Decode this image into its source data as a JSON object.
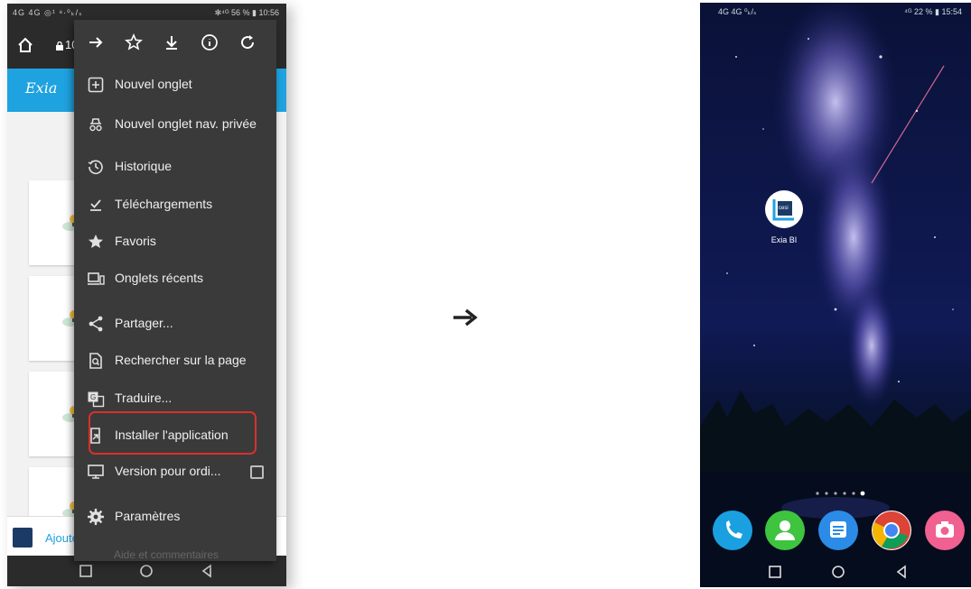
{
  "left_phone": {
    "status": {
      "left": "4G  4G  ◎¹  ⁸·⁰ₖ/ₛ",
      "right": "✻⁴ᴳ 56 % ▮ 10:56"
    },
    "url_text": "10",
    "site_logo": "Exia",
    "bottom_banner_text": "Ajouter",
    "menu": {
      "items": [
        {
          "label": "Nouvel onglet",
          "icon": "new-tab-icon"
        },
        {
          "label": "Nouvel onglet nav. privée",
          "icon": "incognito-icon"
        },
        {
          "label": "Historique",
          "icon": "history-icon"
        },
        {
          "label": "Téléchargements",
          "icon": "download-check-icon"
        },
        {
          "label": "Favoris",
          "icon": "star-icon"
        },
        {
          "label": "Onglets récents",
          "icon": "recent-tabs-icon"
        },
        {
          "label": "Partager...",
          "icon": "share-icon"
        },
        {
          "label": "Rechercher sur la page",
          "icon": "find-in-page-icon"
        },
        {
          "label": "Traduire...",
          "icon": "translate-icon"
        },
        {
          "label": "Installer l'application",
          "icon": "install-app-icon"
        },
        {
          "label": "Version pour ordi...",
          "icon": "desktop-icon"
        },
        {
          "label": "Paramètres",
          "icon": "settings-gear-icon"
        }
      ],
      "faded_item": "Aide et commentaires",
      "highlighted_item": "Installer l'application"
    }
  },
  "right_phone": {
    "status": {
      "left": "4G  4G  ⁰ₖ/ₛ",
      "right": "⁴ᴳ 22 % ▮ 15:54"
    },
    "app_icon_text": "cesi",
    "app_label": "Exia BI",
    "dock": [
      "phone-icon",
      "contacts-icon",
      "messages-icon",
      "chrome-icon",
      "camera-icon"
    ]
  },
  "colors": {
    "accent_blue": "#1fa2e0",
    "menu_bg": "#3a3a3a",
    "highlight_red": "#d9302c"
  }
}
